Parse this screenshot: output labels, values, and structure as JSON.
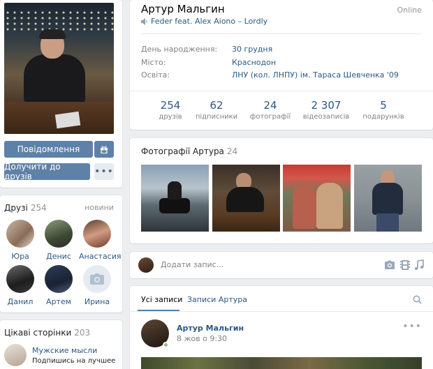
{
  "profile": {
    "name": "Артур Мальгин",
    "online": "Online",
    "status": "Feder feat. Alex Aiono – Lordly",
    "info": [
      {
        "label": "День народження:",
        "value": "30 грудня"
      },
      {
        "label": "Місто:",
        "value": "Краснодон"
      },
      {
        "label": "Освіта:",
        "value": "ЛНУ (кол. ЛНПУ) ім. Тараса Шевченка '09"
      }
    ],
    "counters": [
      {
        "number": "254",
        "label": "друзів"
      },
      {
        "number": "62",
        "label": "підписники"
      },
      {
        "number": "24",
        "label": "фотографії"
      },
      {
        "number": "2 307",
        "label": "відеозаписів"
      },
      {
        "number": "5",
        "label": "подарунків"
      }
    ]
  },
  "actions": {
    "message": "Повідомлення",
    "add_friend": "Долучити до друзів",
    "more": "•••"
  },
  "friends": {
    "title": "Друзі",
    "count": "254",
    "link": "новини",
    "items": [
      {
        "name": "Юра"
      },
      {
        "name": "Денис"
      },
      {
        "name": "Анастасия"
      },
      {
        "name": "Данил"
      },
      {
        "name": "Артем"
      },
      {
        "name": "Ирина"
      }
    ]
  },
  "stories": {
    "title": "Цікаві сторінки",
    "count": "203",
    "first_title": "Мужские мысли",
    "first_sub": "Подпишись на лучшее"
  },
  "photos": {
    "title": "Фотографії Артура",
    "count": "24"
  },
  "composer": {
    "placeholder": "Додати запис..."
  },
  "wall": {
    "tabs": [
      "Усі записи",
      "Записи Артура"
    ],
    "post": {
      "author": "Артур Мальгин",
      "date": "8 жов о 9:30"
    }
  },
  "colors": {
    "link": "#2a5885",
    "button": "#5e81a8",
    "muted": "#828282",
    "online": "#8ac176"
  }
}
